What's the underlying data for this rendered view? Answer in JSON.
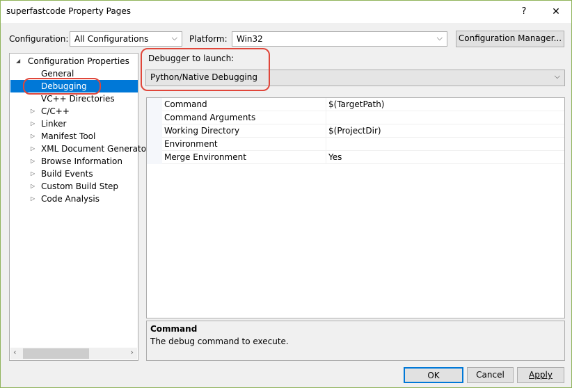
{
  "window": {
    "title": "superfastcode Property Pages",
    "help": "?",
    "close": "✕"
  },
  "config": {
    "label": "Configuration:",
    "value": "All Configurations",
    "platform_label": "Platform:",
    "platform_value": "Win32",
    "manager_button": "Configuration Manager..."
  },
  "tree": {
    "root": "Configuration Properties",
    "items": [
      {
        "label": "General",
        "expandable": false
      },
      {
        "label": "Debugging",
        "expandable": false,
        "selected": true
      },
      {
        "label": "VC++ Directories",
        "expandable": false
      },
      {
        "label": "C/C++",
        "expandable": true
      },
      {
        "label": "Linker",
        "expandable": true
      },
      {
        "label": "Manifest Tool",
        "expandable": true
      },
      {
        "label": "XML Document Generator",
        "expandable": true
      },
      {
        "label": "Browse Information",
        "expandable": true
      },
      {
        "label": "Build Events",
        "expandable": true
      },
      {
        "label": "Custom Build Step",
        "expandable": true
      },
      {
        "label": "Code Analysis",
        "expandable": true
      }
    ]
  },
  "debugger": {
    "label": "Debugger to launch:",
    "value": "Python/Native Debugging"
  },
  "properties": [
    {
      "name": "Command",
      "value": "$(TargetPath)"
    },
    {
      "name": "Command Arguments",
      "value": ""
    },
    {
      "name": "Working Directory",
      "value": "$(ProjectDir)"
    },
    {
      "name": "Environment",
      "value": ""
    },
    {
      "name": "Merge Environment",
      "value": "Yes"
    }
  ],
  "description": {
    "title": "Command",
    "text": "The debug command to execute."
  },
  "buttons": {
    "ok": "OK",
    "cancel": "Cancel",
    "apply": "Apply"
  },
  "colors": {
    "selection": "#0078d7",
    "highlight": "#e0463a"
  }
}
